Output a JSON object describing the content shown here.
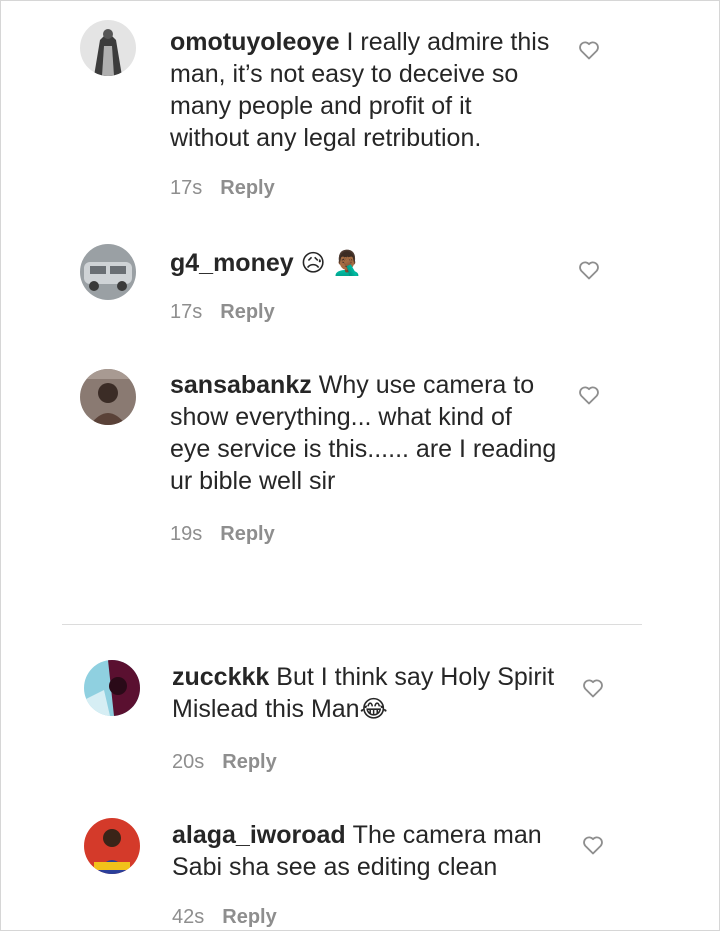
{
  "comments": [
    {
      "username": "omotuyoleoye",
      "text_lines": [
        "I really admire this",
        "man, it’s not easy to deceive so",
        "many people and profit of it",
        "without any legal retribution."
      ],
      "emoji": "",
      "time": "17s",
      "reply_label": "Reply",
      "avatar_colors": [
        "#b0b0b0",
        "#3c3c3c"
      ]
    },
    {
      "username": "g4_money",
      "text_lines": [
        ""
      ],
      "emoji": "😥 🤦🏾‍♂️",
      "time": "17s",
      "reply_label": "Reply",
      "avatar_colors": [
        "#cfd3d6",
        "#6a6f74"
      ]
    },
    {
      "username": "sansabankz",
      "text_lines": [
        "Why use camera to",
        "show everything... what kind of",
        "eye service is this...... are I reading",
        "ur bible well sir"
      ],
      "emoji": "",
      "time": "19s",
      "reply_label": "Reply",
      "avatar_colors": [
        "#8a7a72",
        "#3b2c26"
      ]
    },
    {
      "username": "zucckkk",
      "text_lines": [
        "But I think say Holy Spirit",
        "Mislead this Man"
      ],
      "emoji": "😂",
      "time": "20s",
      "reply_label": "Reply",
      "avatar_colors": [
        "#8fd0e0",
        "#5a1030"
      ]
    },
    {
      "username": "alaga_iworoad",
      "text_lines": [
        "The camera man",
        "Sabi sha see as editing clean"
      ],
      "emoji": "",
      "time": "42s",
      "reply_label": "Reply",
      "avatar_colors": [
        "#d43a2a",
        "#2a3f9a"
      ]
    }
  ],
  "colors": {
    "text": "#262626",
    "meta": "#8e8e8e",
    "divider": "#dcdcdc",
    "heart_stroke": "#8e8e8e"
  },
  "icons": {
    "like": "heart-outline-icon"
  }
}
